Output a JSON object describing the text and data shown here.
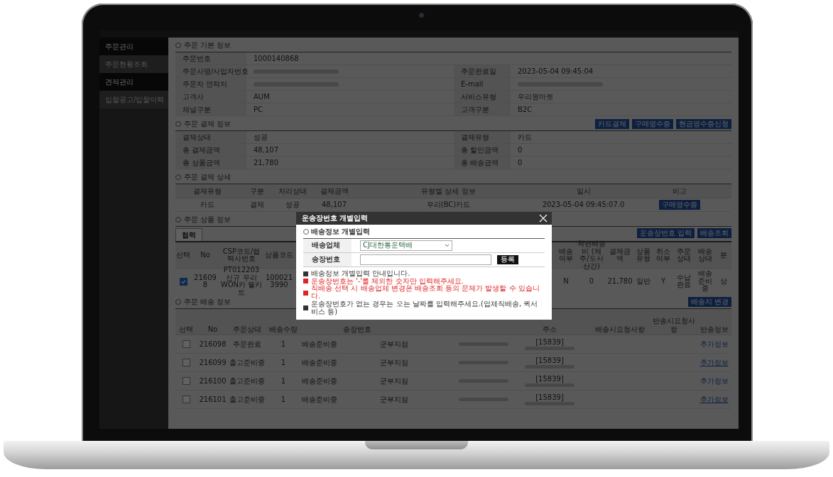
{
  "sidebar": {
    "items": [
      {
        "label": "주문관리",
        "selected": true
      },
      {
        "label": "주문현황조회",
        "selected": false
      },
      {
        "label": "견적관리",
        "selected": true
      },
      {
        "label": "입찰공고/입찰이력",
        "selected": false
      }
    ]
  },
  "order_info": {
    "title": "주문 기본 정보",
    "rows": [
      [
        {
          "label": "주문번호",
          "value": "1000140868"
        }
      ],
      [
        {
          "label": "주문사명/사업자번호",
          "redacted": true
        },
        {
          "label": "주문완료일",
          "value": "2023-05-04 09:45:04"
        }
      ],
      [
        {
          "label": "주문자 연락처",
          "redacted": true
        },
        {
          "label": "E-mail",
          "redacted": true
        }
      ],
      [
        {
          "label": "고객사",
          "value": "AUM"
        },
        {
          "label": "서비스유형",
          "value": "우리원마켓"
        }
      ],
      [
        {
          "label": "채널구분",
          "value": "PC"
        },
        {
          "label": "고객구분",
          "value": "B2C"
        }
      ]
    ]
  },
  "payment": {
    "title": "주문 결제 정보",
    "buttons": [
      "카드결제",
      "구매영수증",
      "현금영수증신청"
    ],
    "rows": [
      [
        {
          "label": "결제상태",
          "value": "성공"
        },
        {
          "label": "결제유형",
          "value": "카드"
        }
      ],
      [
        {
          "label": "총 결제금액",
          "value": "48,107"
        },
        {
          "label": "총 할인금액",
          "value": "0"
        }
      ],
      [
        {
          "label": "총 상품금액",
          "value": "21,780"
        },
        {
          "label": "총 배송금액",
          "value": "0"
        }
      ]
    ]
  },
  "payment_detail": {
    "title": "주문 결제 상세",
    "columns": [
      "결제유형",
      "구분",
      "처리상태",
      "결제금액",
      "유형별 상세 정보",
      "일시",
      "비고"
    ],
    "rows": [
      {
        "cells": [
          "카드",
          "결제",
          "성공",
          "48,107",
          "우리(BC)카드",
          "2023-05-04 09:45:07.0"
        ],
        "button": "구매영수증"
      }
    ]
  },
  "products": {
    "title": "주문 상품 정보",
    "tab": {
      "label": "협력",
      "selected": true
    },
    "buttons": [
      "운송장번호 입력",
      "배송조회"
    ],
    "columns": [
      "선택",
      "No",
      "CSP코드/협력사번호",
      "상품코드",
      "배송여부",
      "착편배송비 (제주/도서산간)",
      "결제금액",
      "상품유형",
      "취소여부",
      "주문상태",
      "배송상태",
      "분"
    ],
    "rows": [
      {
        "cells": [
          {
            "kind": "checkbox",
            "checked": true
          },
          {
            "kind": "text",
            "text": "216098"
          },
          {
            "kind": "text",
            "text": "PT012203 신규 우리WON카 웰키트"
          },
          {
            "kind": "text",
            "text": "1000213990"
          },
          {
            "kind": "text",
            "text": "N"
          },
          {
            "kind": "text",
            "text": "0"
          },
          {
            "kind": "text",
            "text": "21,780"
          },
          {
            "kind": "text",
            "text": "일반"
          },
          {
            "kind": "text",
            "text": "Y"
          },
          {
            "kind": "text",
            "text": "수납완료"
          },
          {
            "kind": "text",
            "text": "배송준비중"
          },
          {
            "kind": "text",
            "text": "상"
          }
        ]
      }
    ]
  },
  "delivery": {
    "title": "주문 배송 정보",
    "button": "배송지 변경",
    "columns": [
      "선택",
      "No",
      "주문상태",
      "배송수량",
      "송장번호",
      "주소",
      "배송시요청사항",
      "반송시요청사항",
      "반송정보"
    ],
    "rows": [
      {
        "checked": false,
        "no": "216098",
        "status": "주문완료",
        "qty": "1",
        "ship_status": "배송준비중",
        "branch": "군부지점",
        "zip": "[15839]",
        "link": "추가정보",
        "underlined": false
      },
      {
        "checked": false,
        "no": "216099",
        "status": "출고준비중",
        "qty": "1",
        "ship_status": "배송준비중",
        "branch": "군부지점",
        "zip": "[15839]",
        "link": "추가정보",
        "underlined": true
      },
      {
        "checked": false,
        "no": "216100",
        "status": "출고준비중",
        "qty": "1",
        "ship_status": "배송준비중",
        "branch": "군부지점",
        "zip": "[15839]",
        "link": "추가정보",
        "underlined": false
      },
      {
        "checked": false,
        "no": "216101",
        "status": "출고준비중",
        "qty": "1",
        "ship_status": "배송준비중",
        "branch": "군부지점",
        "zip": "[15839]",
        "link": "추가정보",
        "underlined": true
      }
    ]
  },
  "modal": {
    "title": "운송장번호 개별입력",
    "section": "배송정보 개별입력",
    "carrier": {
      "label": "배송업체",
      "value": "CJ대한통운택배"
    },
    "tracking": {
      "label": "송장번호",
      "button": "등록"
    },
    "notes": [
      {
        "text": "배송정보 개별입력 안내입니다.",
        "color": "#333333"
      },
      {
        "text": "운송장번호는 '-'를 제외한 숫자만 입력해주세요.",
        "color": "#e02424"
      },
      {
        "text": "직배송 선택 시 배송업체 변경은 배송조회 등의 문제가 발생할 수 있습니다.",
        "color": "#e02424"
      },
      {
        "text": "운송장번호가 없는 경우는 오는 날짜를 입력해주세요.(업체직배송, 퀵서비스 등)",
        "color": "#333333"
      }
    ]
  }
}
